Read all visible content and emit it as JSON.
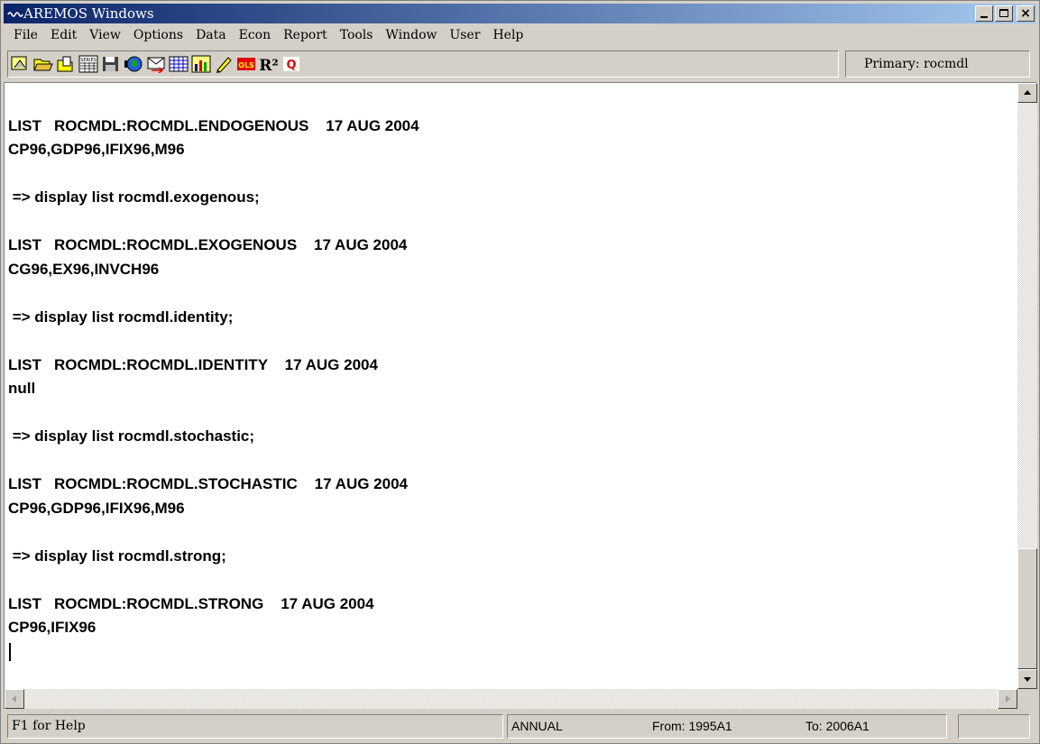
{
  "window": {
    "title": "AREMOS Windows",
    "title_icon": "aremos-logo",
    "accent_color": "#0a246a"
  },
  "menu": [
    "File",
    "Edit",
    "View",
    "Options",
    "Data",
    "Econ",
    "Report",
    "Tools",
    "Window",
    "User",
    "Help"
  ],
  "toolbar": {
    "buttons": [
      "workspace-icon",
      "open-folder-icon",
      "open-file-icon",
      "series-icon",
      "save-icon",
      "globe-icon",
      "mail-icon",
      "table-icon",
      "chart-icon",
      "pencil-icon",
      "ols-icon",
      "r-squared-icon",
      "q-icon"
    ],
    "ols_label": "OLS",
    "r2_label": "R²",
    "q_label": "Q",
    "series_label": "SERIES",
    "primary": "Primary: rocmdl"
  },
  "console": {
    "lines": [
      "",
      "LIST   ROCMDL:ROCMDL.ENDOGENOUS    17 AUG 2004",
      "CP96,GDP96,IFIX96,M96",
      "",
      " => display list rocmdl.exogenous;",
      "",
      "LIST   ROCMDL:ROCMDL.EXOGENOUS    17 AUG 2004",
      "CG96,EX96,INVCH96",
      "",
      " => display list rocmdl.identity;",
      "",
      "LIST   ROCMDL:ROCMDL.IDENTITY    17 AUG 2004",
      "null",
      "",
      " => display list rocmdl.stochastic;",
      "",
      "LIST   ROCMDL:ROCMDL.STOCHASTIC    17 AUG 2004",
      "CP96,GDP96,IFIX96,M96",
      "",
      " => display list rocmdl.strong;",
      "",
      "LIST   ROCMDL:ROCMDL.STRONG    17 AUG 2004",
      "CP96,IFIX96",
      ""
    ]
  },
  "status": {
    "help": "F1 for Help",
    "frequency": "ANNUAL",
    "from": "From:  1995A1",
    "to": "To:  2006A1"
  }
}
